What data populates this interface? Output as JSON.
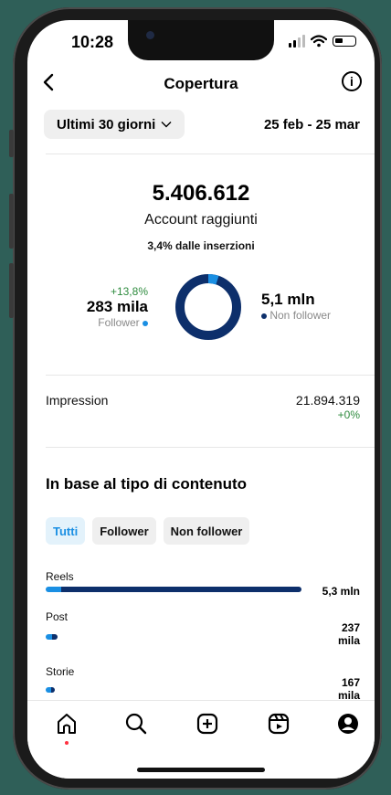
{
  "status": {
    "time": "10:28"
  },
  "header": {
    "title": "Copertura"
  },
  "filters": {
    "period": "Ultimi 30 giorni",
    "date_range": "25 feb - 25 mar"
  },
  "summary": {
    "accounts_reached": "5.406.612",
    "accounts_reached_label": "Account raggiunti",
    "from_ads": "3,4% dalle inserzioni"
  },
  "followers": {
    "change": "+13,8%",
    "value": "283 mila",
    "label": "Follower",
    "color": "#1a8fe3",
    "share": 0.052
  },
  "non_followers": {
    "value": "5,1 mln",
    "label": "Non follower",
    "color": "#0d2f6b",
    "share": 0.948
  },
  "impressions": {
    "label": "Impression",
    "value": "21.894.319",
    "change": "+0%"
  },
  "content_section": {
    "title": "In base al tipo di contenuto",
    "tabs": [
      "Tutti",
      "Follower",
      "Non follower"
    ],
    "active_tab": "Tutti",
    "rows": [
      {
        "label": "Reels",
        "value": "5,3 mln",
        "follower_frac": 0.06,
        "total_frac": 1.0
      },
      {
        "label": "Post",
        "value": "237 mila",
        "follower_frac": 0.55,
        "total_frac": 0.045
      },
      {
        "label": "Storie",
        "value": "167 mila",
        "follower_frac": 0.6,
        "total_frac": 0.032
      }
    ]
  },
  "tabbar": {
    "icons": [
      "home-icon",
      "search-icon",
      "create-icon",
      "reels-icon",
      "profile-icon"
    ]
  }
}
